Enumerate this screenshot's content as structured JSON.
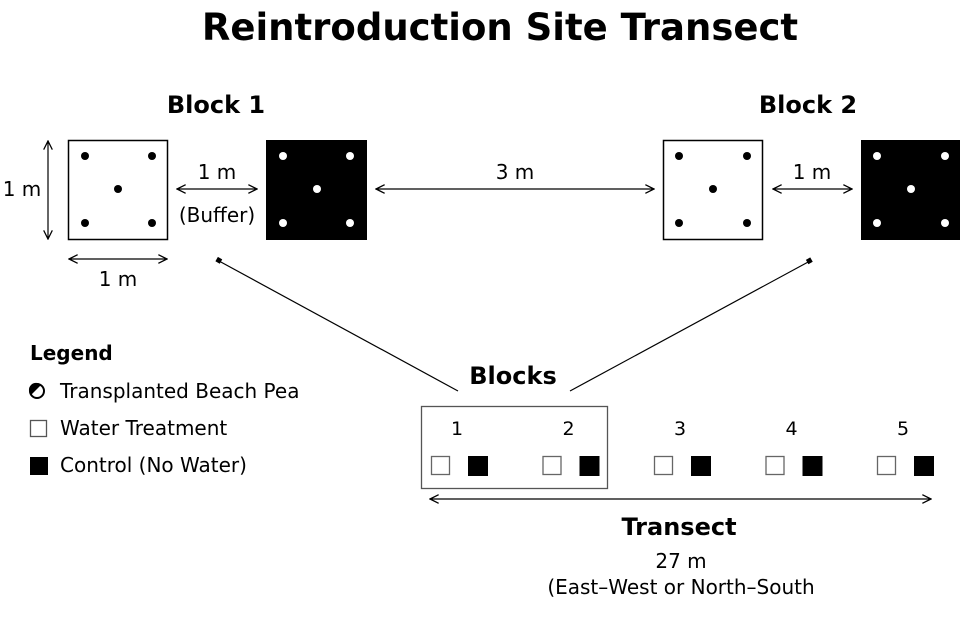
{
  "title": "Reintroduction Site Transect",
  "detail": {
    "block1_label": "Block 1",
    "block2_label": "Block 2",
    "height_label": "1 m",
    "width_label": "1 m",
    "buffer_distance": "1 m",
    "buffer_label": "(Buffer)",
    "between_blocks_distance": "3 m",
    "block2_buffer_distance": "1 m"
  },
  "legend": {
    "title": "Legend",
    "items": [
      {
        "label": "Transplanted Beach Pea",
        "icon": "half-filled-circle-icon"
      },
      {
        "label": "Water Treatment",
        "icon": "open-square-icon"
      },
      {
        "label": "Control (No Water)",
        "icon": "filled-square-icon"
      }
    ]
  },
  "overview": {
    "blocks_heading": "Blocks",
    "block_numbers": [
      "1",
      "2",
      "3",
      "4",
      "5"
    ],
    "transect_label": "Transect",
    "transect_length": "27 m",
    "transect_orientation": "(East–West or North–South"
  }
}
